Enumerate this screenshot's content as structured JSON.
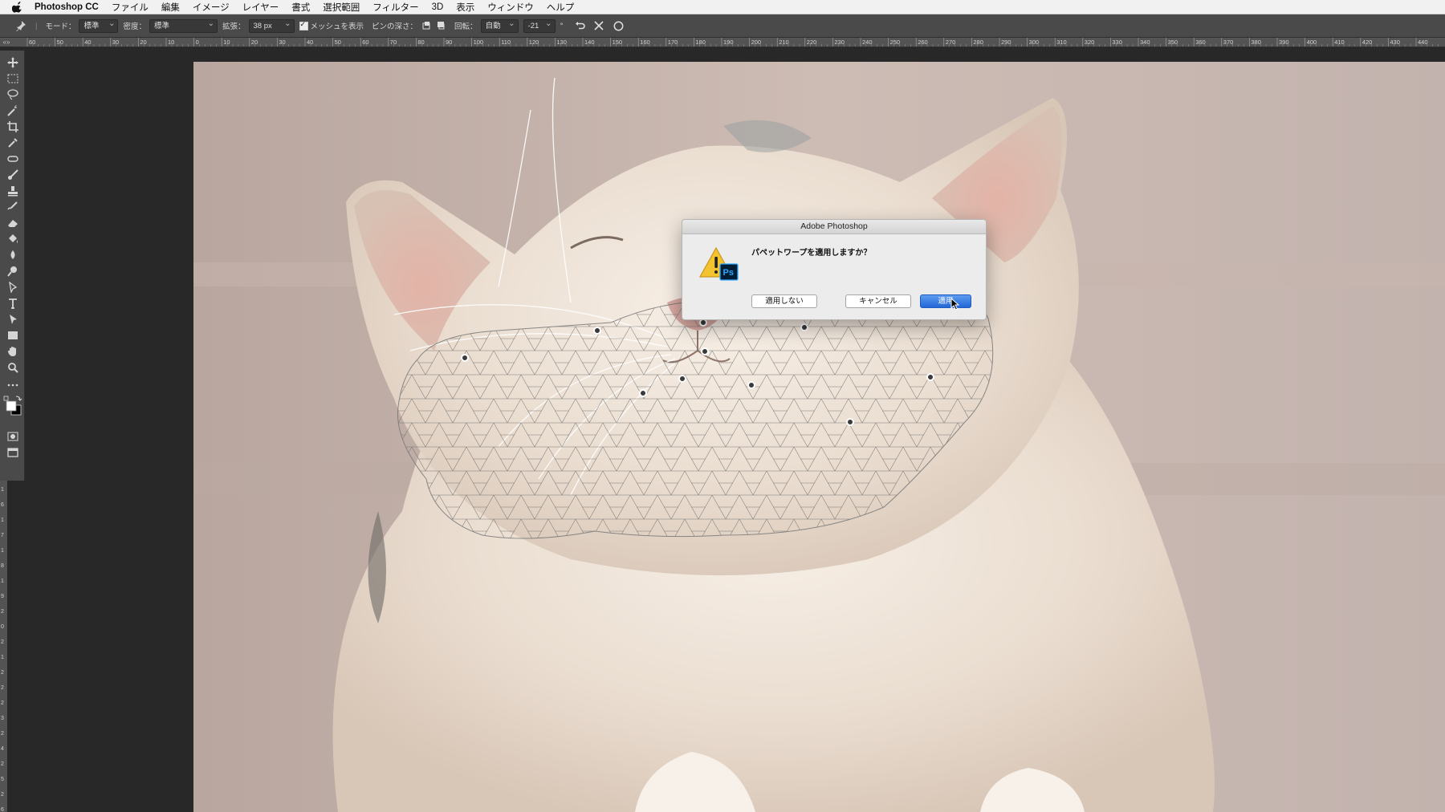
{
  "menubar": {
    "app_name": "Photoshop CC",
    "items": [
      "ファイル",
      "編集",
      "イメージ",
      "レイヤー",
      "書式",
      "選択範囲",
      "フィルター",
      "3D",
      "表示",
      "ウィンドウ",
      "ヘルプ"
    ]
  },
  "options_bar": {
    "mode_label": "モード：",
    "mode_value": "標準",
    "density_label": "密度：",
    "density_value": "標準",
    "expansion_label": "拡張：",
    "expansion_value": "38 px",
    "show_mesh_label": "メッシュを表示",
    "pin_depth_label": "ピンの深さ：",
    "rotate_label": "回転：",
    "rotate_mode": "自動",
    "rotate_value": "-21",
    "degree_symbol": "°",
    "icons": [
      "pin-tool-icon",
      "pin-forward-icon",
      "pin-backward-icon",
      "undo-icon",
      "cancel-icon",
      "commit-icon"
    ]
  },
  "ruler": {
    "top_ticks": [
      "60",
      "50",
      "40",
      "30",
      "20",
      "10",
      "0",
      "10",
      "20",
      "30",
      "40",
      "50",
      "60",
      "70",
      "80",
      "90",
      "100",
      "110",
      "120",
      "130",
      "140",
      "150",
      "160",
      "170",
      "180",
      "190",
      "200",
      "210",
      "220",
      "230",
      "240",
      "250",
      "260",
      "270",
      "280",
      "290",
      "300",
      "310",
      "320",
      "330",
      "340",
      "350",
      "360",
      "370",
      "380",
      "390",
      "400",
      "410",
      "420",
      "430",
      "440"
    ],
    "left_ticks": [
      "1",
      "6",
      "1",
      "7",
      "1",
      "8",
      "1",
      "9",
      "2",
      "0",
      "2",
      "1",
      "2",
      "2",
      "2",
      "3",
      "2",
      "4",
      "2",
      "5",
      "2",
      "6"
    ]
  },
  "toolbar": {
    "tools": [
      "move-tool-icon",
      "marquee-tool-icon",
      "lasso-tool-icon",
      "magic-wand-tool-icon",
      "crop-tool-icon",
      "eyedropper-tool-icon",
      "healing-brush-tool-icon",
      "brush-tool-icon",
      "clone-stamp-tool-icon",
      "history-brush-tool-icon",
      "eraser-tool-icon",
      "paint-bucket-tool-icon",
      "blur-tool-icon",
      "dodge-tool-icon",
      "pen-tool-icon",
      "type-tool-icon",
      "path-selection-tool-icon",
      "rectangle-tool-icon",
      "hand-tool-icon",
      "zoom-tool-icon",
      "more-tools-icon"
    ],
    "foreground_color": "#ffffff",
    "background_color": "#000000"
  },
  "dialog": {
    "title": "Adobe Photoshop",
    "message": "パペットワープを適用しますか？",
    "icon": "warning-photoshop-icon",
    "buttons": {
      "dont_apply": "適用しない",
      "cancel": "キャンセル",
      "apply": "適用"
    },
    "default_color": "#2366d6"
  },
  "canvas": {
    "description_visible": false,
    "pin_count": 12
  }
}
